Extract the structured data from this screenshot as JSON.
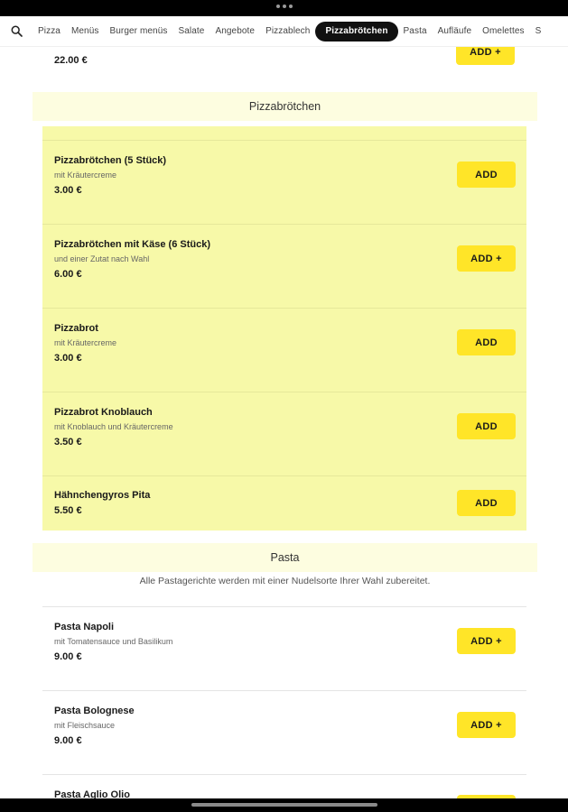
{
  "nav": {
    "search_icon": "search-icon",
    "tabs": [
      {
        "label": "Pizza",
        "active": false
      },
      {
        "label": "Menüs",
        "active": false
      },
      {
        "label": "Burger menüs",
        "active": false
      },
      {
        "label": "Salate",
        "active": false
      },
      {
        "label": "Angebote",
        "active": false
      },
      {
        "label": "Pizzablech",
        "active": false
      },
      {
        "label": "Pizzabrötchen",
        "active": true
      },
      {
        "label": "Pasta",
        "active": false
      },
      {
        "label": "Aufläufe",
        "active": false
      },
      {
        "label": "Omelettes",
        "active": false
      },
      {
        "label": "S",
        "active": false
      }
    ]
  },
  "previous_item": {
    "price": "22.00 €",
    "add_label": "ADD +"
  },
  "sections": [
    {
      "title": "Pizzabrötchen",
      "note": "",
      "items": [
        {
          "name": "Pizzabrötchen (5 Stück)",
          "description": "mit Kräutercreme",
          "price": "3.00 €",
          "add_label": "ADD"
        },
        {
          "name": "Pizzabrötchen mit Käse (6 Stück)",
          "description": "und einer Zutat nach Wahl",
          "price": "6.00 €",
          "add_label": "ADD +"
        },
        {
          "name": "Pizzabrot",
          "description": "mit Kräutercreme",
          "price": "3.00 €",
          "add_label": "ADD"
        },
        {
          "name": "Pizzabrot Knoblauch",
          "description": "mit Knoblauch und Kräutercreme",
          "price": "3.50 €",
          "add_label": "ADD"
        },
        {
          "name": "Hähnchengyros Pita",
          "description": "",
          "price": "5.50 €",
          "add_label": "ADD"
        }
      ]
    },
    {
      "title": "Pasta",
      "note": "Alle Pastagerichte werden mit einer Nudelsorte Ihrer Wahl zubereitet.",
      "items": [
        {
          "name": "Pasta Napoli",
          "description": "mit Tomatensauce und Basilikum",
          "price": "9.00 €",
          "add_label": "ADD +"
        },
        {
          "name": "Pasta Bolognese",
          "description": "mit Fleischsauce",
          "price": "9.00 €",
          "add_label": "ADD +"
        },
        {
          "name": "Pasta Aglio Olio",
          "description": "",
          "price": "",
          "add_label": ""
        }
      ]
    }
  ],
  "colors": {
    "accent_yellow": "#ffe528",
    "highlight_bg": "#f7f9a8",
    "header_bg": "#fdfde0",
    "active_tab_bg": "#111111"
  }
}
